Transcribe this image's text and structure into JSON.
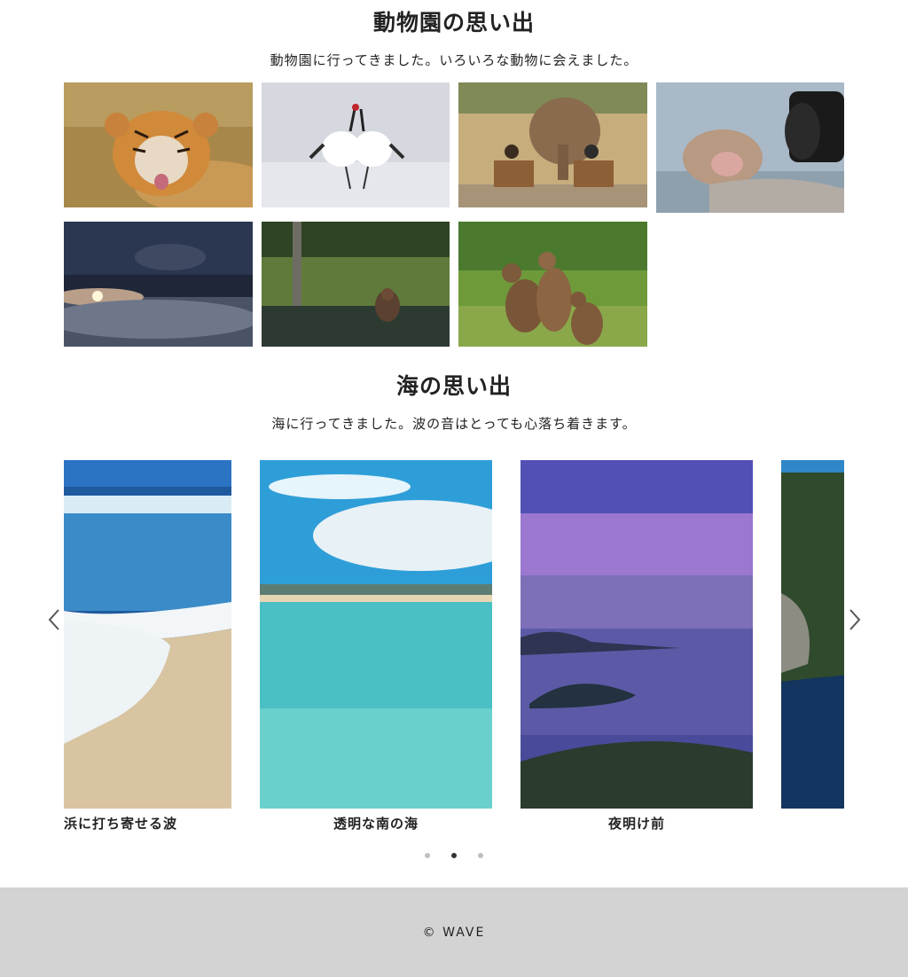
{
  "zoo": {
    "title": "動物園の思い出",
    "description": "動物園に行ってきました。いろいろな動物に会えました。",
    "photos": [
      {
        "subject": "tiger"
      },
      {
        "subject": "cranes"
      },
      {
        "subject": "elephant"
      },
      {
        "subject": "snow-monkey"
      },
      {
        "subject": "swans-sunrise"
      },
      {
        "subject": "bear-in-water"
      },
      {
        "subject": "bear-cubs"
      }
    ]
  },
  "sea": {
    "title": "海の思い出",
    "description": "海に行ってきました。波の音はとっても心落ち着きます。",
    "slides": [
      {
        "caption": "浜に打ち寄せる波"
      },
      {
        "caption": "透明な南の海"
      },
      {
        "caption": "夜明け前"
      },
      {
        "caption": ""
      }
    ],
    "dots": 3,
    "active_dot": 2
  },
  "footer": {
    "copyright": "© WAVE"
  }
}
